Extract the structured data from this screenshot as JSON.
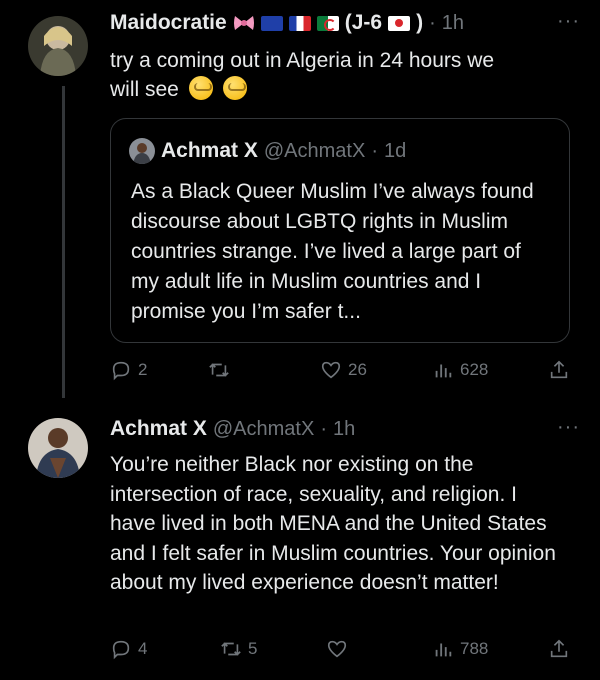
{
  "tweet1": {
    "display_name": "Maidocratie",
    "name_suffix": "(J-6",
    "name_suffix_close": ")",
    "dot": "·",
    "time": "1h",
    "more": "···",
    "text_line1": "try a coming out in Algeria in 24 hours we",
    "text_line2": "will see",
    "quote": {
      "display_name": "Achmat X",
      "handle": "@AchmatX",
      "dot": "·",
      "time": "1d",
      "text": "As a Black Queer Muslim I’ve always found discourse about LGBTQ rights in Muslim countries strange. I’ve lived a large part of my adult life in Muslim countries and I promise you I’m safer t..."
    },
    "actions": {
      "reply_count": "2",
      "retweet_count": "",
      "like_count": "26",
      "views_count": "628"
    }
  },
  "tweet2": {
    "display_name": "Achmat X",
    "handle": "@AchmatX",
    "dot": "·",
    "time": "1h",
    "more": "···",
    "text": "You’re neither Black nor existing on the intersection of race, sexuality, and religion. I have lived in both MENA and the United States and I felt safer in Muslim countries. Your opinion about my lived experience doesn’t matter!",
    "actions": {
      "reply_count": "4",
      "retweet_count": "5",
      "like_count": "",
      "views_count": "788"
    }
  },
  "colors": {
    "background": "#000000",
    "text": "#e7e9ea",
    "secondary": "#71767b",
    "border": "#333639"
  }
}
